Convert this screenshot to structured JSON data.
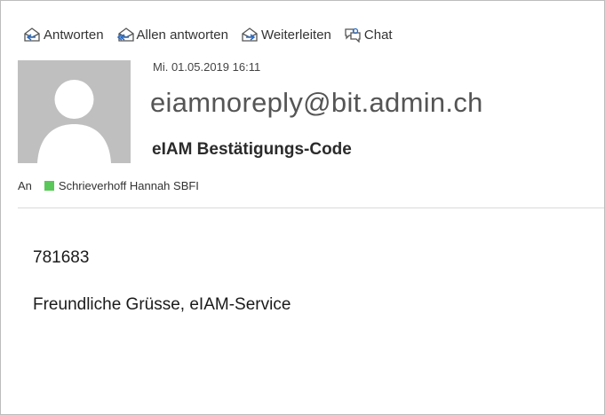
{
  "toolbar": {
    "reply_label": "Antworten",
    "reply_all_label": "Allen antworten",
    "forward_label": "Weiterleiten",
    "chat_label": "Chat"
  },
  "message": {
    "datetime": "Mi. 01.05.2019 16:11",
    "sender": "eiamnoreply@bit.admin.ch",
    "subject": "eIAM Bestätigungs-Code",
    "to_label": "An",
    "recipient": "Schrieverhoff Hannah SBFI",
    "recipient_presence_color": "#5ac75a"
  },
  "body": {
    "code": "781683",
    "greeting": "Freundliche Grüsse, eIAM-Service"
  },
  "icons": {
    "reply": "reply-icon",
    "reply_all": "reply-all-icon",
    "forward": "forward-icon",
    "chat": "chat-icon",
    "avatar": "default-avatar"
  }
}
